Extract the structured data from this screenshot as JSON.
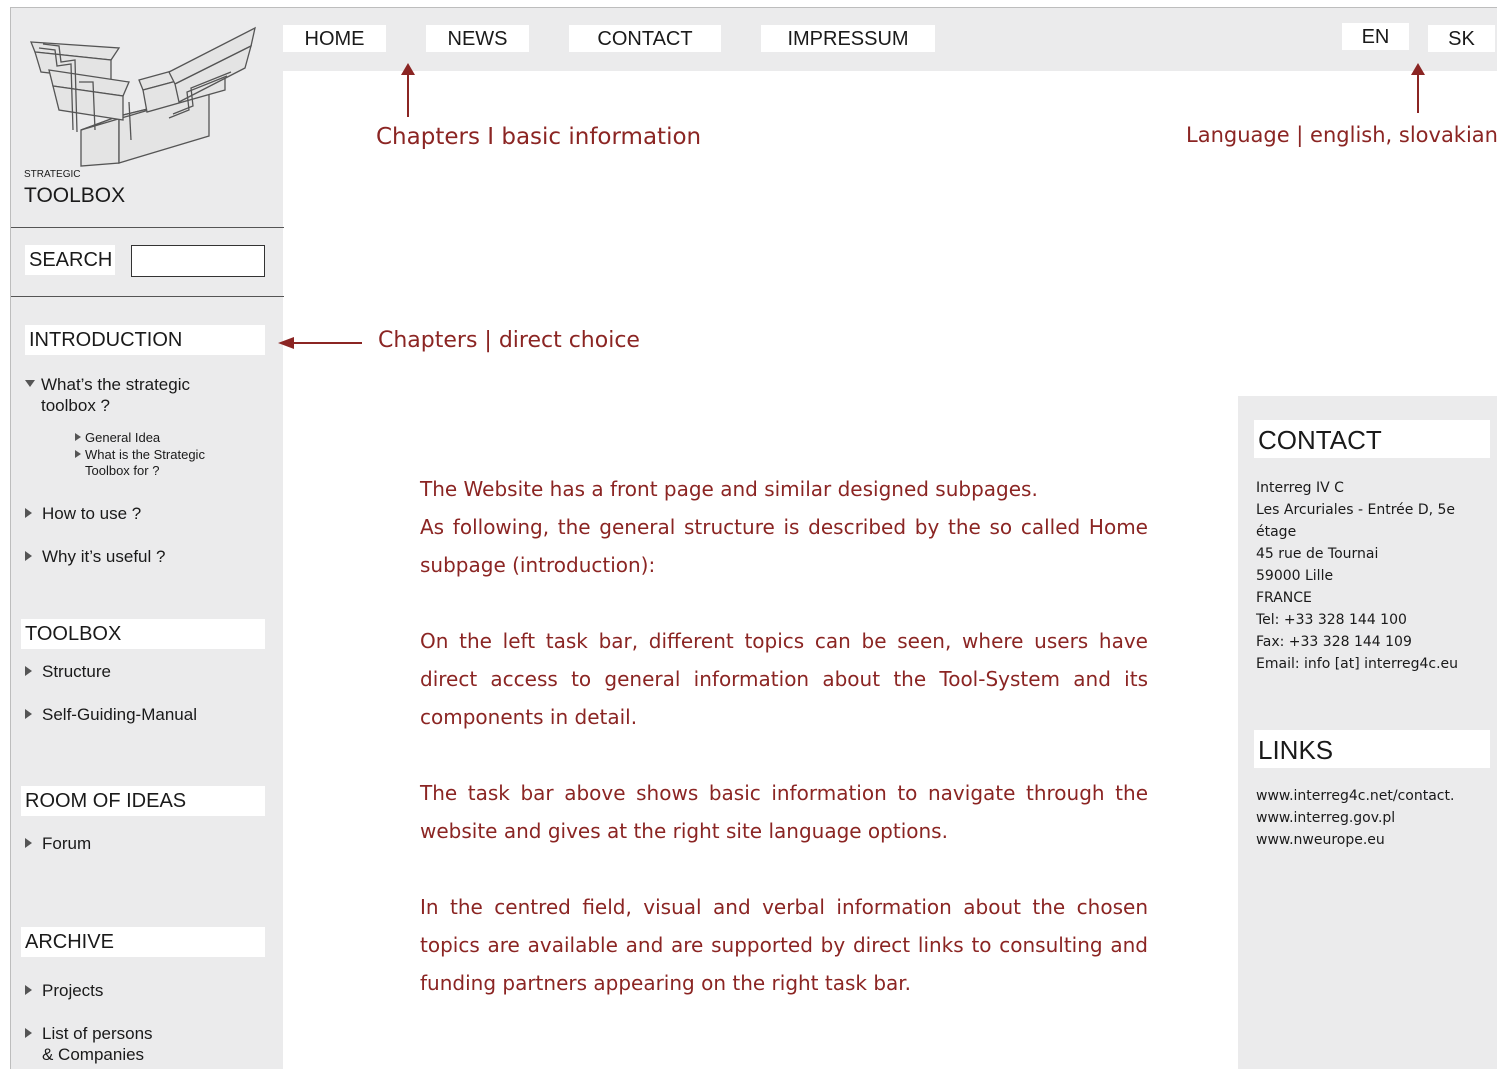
{
  "sidebar": {
    "logo_small": "STRATEGIC",
    "logo_big": "TOOLBOX",
    "search_label": "SEARCH",
    "search_value": "",
    "introduction": {
      "heading": "INTRODUCTION",
      "item1": "What’s the strategic toolbox ?",
      "sub1": "General Idea",
      "sub2": "What is the Strategic Toolbox for ?",
      "item2": "How to use ?",
      "item3": "Why it’s useful ?"
    },
    "toolbox": {
      "heading": "TOOLBOX",
      "item1": "Structure",
      "item2": "Self-Guiding-Manual"
    },
    "room": {
      "heading": "ROOM OF IDEAS",
      "item1": "Forum"
    },
    "archive": {
      "heading": "ARCHIVE",
      "item1": "Projects",
      "item2_line1": "List of persons",
      "item2_line2": "& Companies"
    }
  },
  "topnav": {
    "home": "HOME",
    "news": "NEWS",
    "contact": "CONTACT",
    "impressum": "IMPRESSUM",
    "lang_en": "EN",
    "lang_sk": "SK"
  },
  "annotations": {
    "chapters_basic": "Chapters I basic information",
    "language": "Language | english, slovakian",
    "chapters_direct": "Chapters | direct choice"
  },
  "main": {
    "p1_line1": "The Website has a front page and similar designed subpages.",
    "p1_line2": "As following, the general structure is described by the so called Home subpage (introduction):",
    "p2": "On the left task bar, different topics can be seen, where users have direct access to general information about the Tool-System and its components in detail.",
    "p3": "The task bar above shows basic information to navigate through the website and gives at the right site language options.",
    "p4": "In the centred field, visual and verbal information about the chosen topics are available and are supported by direct links to consulting and funding partners appearing on the right task bar."
  },
  "right": {
    "contact_heading": "CONTACT",
    "contact_lines": [
      "Interreg IV C",
      "Les Arcuriales - Entrée D, 5e étage",
      "45 rue de Tournai",
      "59000 Lille",
      "FRANCE",
      "Tel: +33 328 144 100",
      "Fax: +33 328 144 109",
      "Email: info [at] interreg4c.eu"
    ],
    "links_heading": "LINKS",
    "links": [
      "www.interreg4c.net/contact.",
      "www.interreg.gov.pl",
      "www.nweurope.eu"
    ]
  },
  "colors": {
    "accent": "#8b2523",
    "panel": "#ebebec"
  }
}
